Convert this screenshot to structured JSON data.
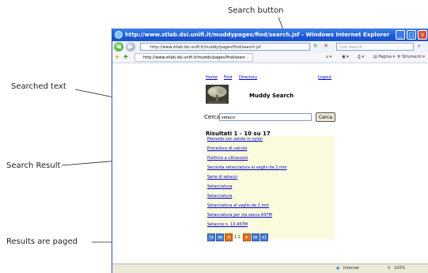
{
  "annotations": {
    "search_button": "Search button",
    "searched_text": "Searched text",
    "search_result": "Search Result",
    "results_paged": "Results are paged"
  },
  "browser": {
    "title": "http://www.stlab.dsi.unifi.it/muddypages/find/search.jsf - Windows Internet Explorer",
    "address": "http://www.stlab.dsi.unifi.it/muddy/pages/find/search.jsf",
    "search_placeholder": "Live Search",
    "tab_title": "http://www.stlab.dsi.unifi.it/muddy/pages/find/searc...",
    "page_menu": "Pagina",
    "tools_menu": "Strumenti",
    "status_zone": "Internet",
    "zoom": "100%",
    "colors": {
      "title_bar": "#1d5ad8",
      "results_bg": "#fafadd",
      "link": "#0000cc"
    }
  },
  "page": {
    "nav": {
      "home": "Home",
      "find": "Find",
      "directory": "Directory",
      "logout": "Logout"
    },
    "brand": "Muddy Search",
    "search_label": "Cerca",
    "query": "setacci",
    "search_button": "Cerca",
    "results_header": "Risultati 1 - 10 su 17",
    "results": [
      "Pennello con setole in nylon",
      "Procedura di calcolo",
      "Pulitrice a ultrasuoni",
      "Seconda setacciatura al vaglio da 2 mm",
      "Serie di setacci",
      "Setacciatura",
      "Setacciatura",
      "Setacciatura al vaglio da 2 mm",
      "Setacciatura per via secca ASTM",
      "Setaccio n. 10 ASTM"
    ],
    "pager": {
      "pages": "1 2",
      "current_page": 1
    }
  }
}
